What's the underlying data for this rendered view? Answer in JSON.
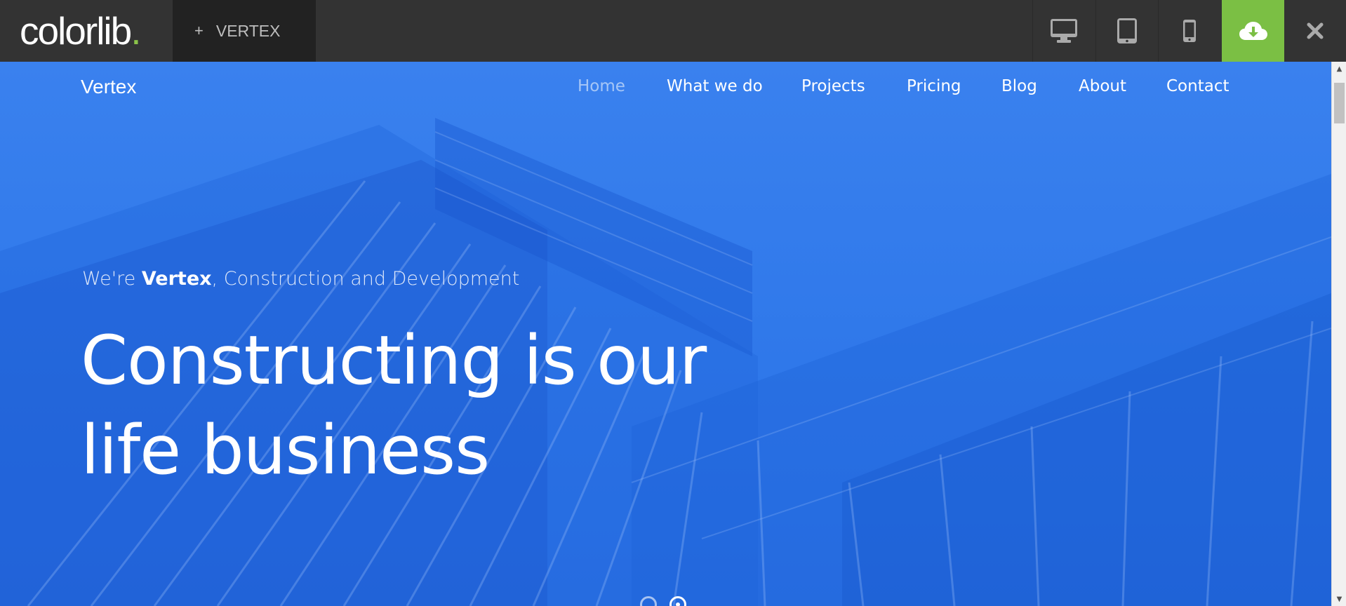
{
  "topbar": {
    "logo_text": "colorlib",
    "logo_dot": ".",
    "theme_tab_plus": "+",
    "theme_tab_label": "VERTEX",
    "accent_color": "#7bbf44"
  },
  "site": {
    "brand": "Vertex",
    "nav": {
      "home": "Home",
      "what_we_do": "What we do",
      "projects": "Projects",
      "pricing": "Pricing",
      "blog": "Blog",
      "about": "About",
      "contact": "Contact"
    },
    "hero": {
      "sub_prefix": "We're ",
      "sub_brand": "Vertex",
      "sub_suffix": ", Construction and Development",
      "title_line1": "Constructing is our",
      "title_line2": "life business"
    },
    "hero_color": "#3a81ee"
  },
  "icons": {
    "desktop": "desktop-icon",
    "tablet": "tablet-icon",
    "mobile": "mobile-icon",
    "download": "cloud-download-icon",
    "close": "close-icon",
    "scroll_up": "scroll-up-arrow",
    "scroll_down": "scroll-down-arrow"
  },
  "slider": {
    "slides": 2,
    "active": 2
  },
  "scrollbar": {
    "up_glyph": "▲",
    "down_glyph": "▼"
  }
}
